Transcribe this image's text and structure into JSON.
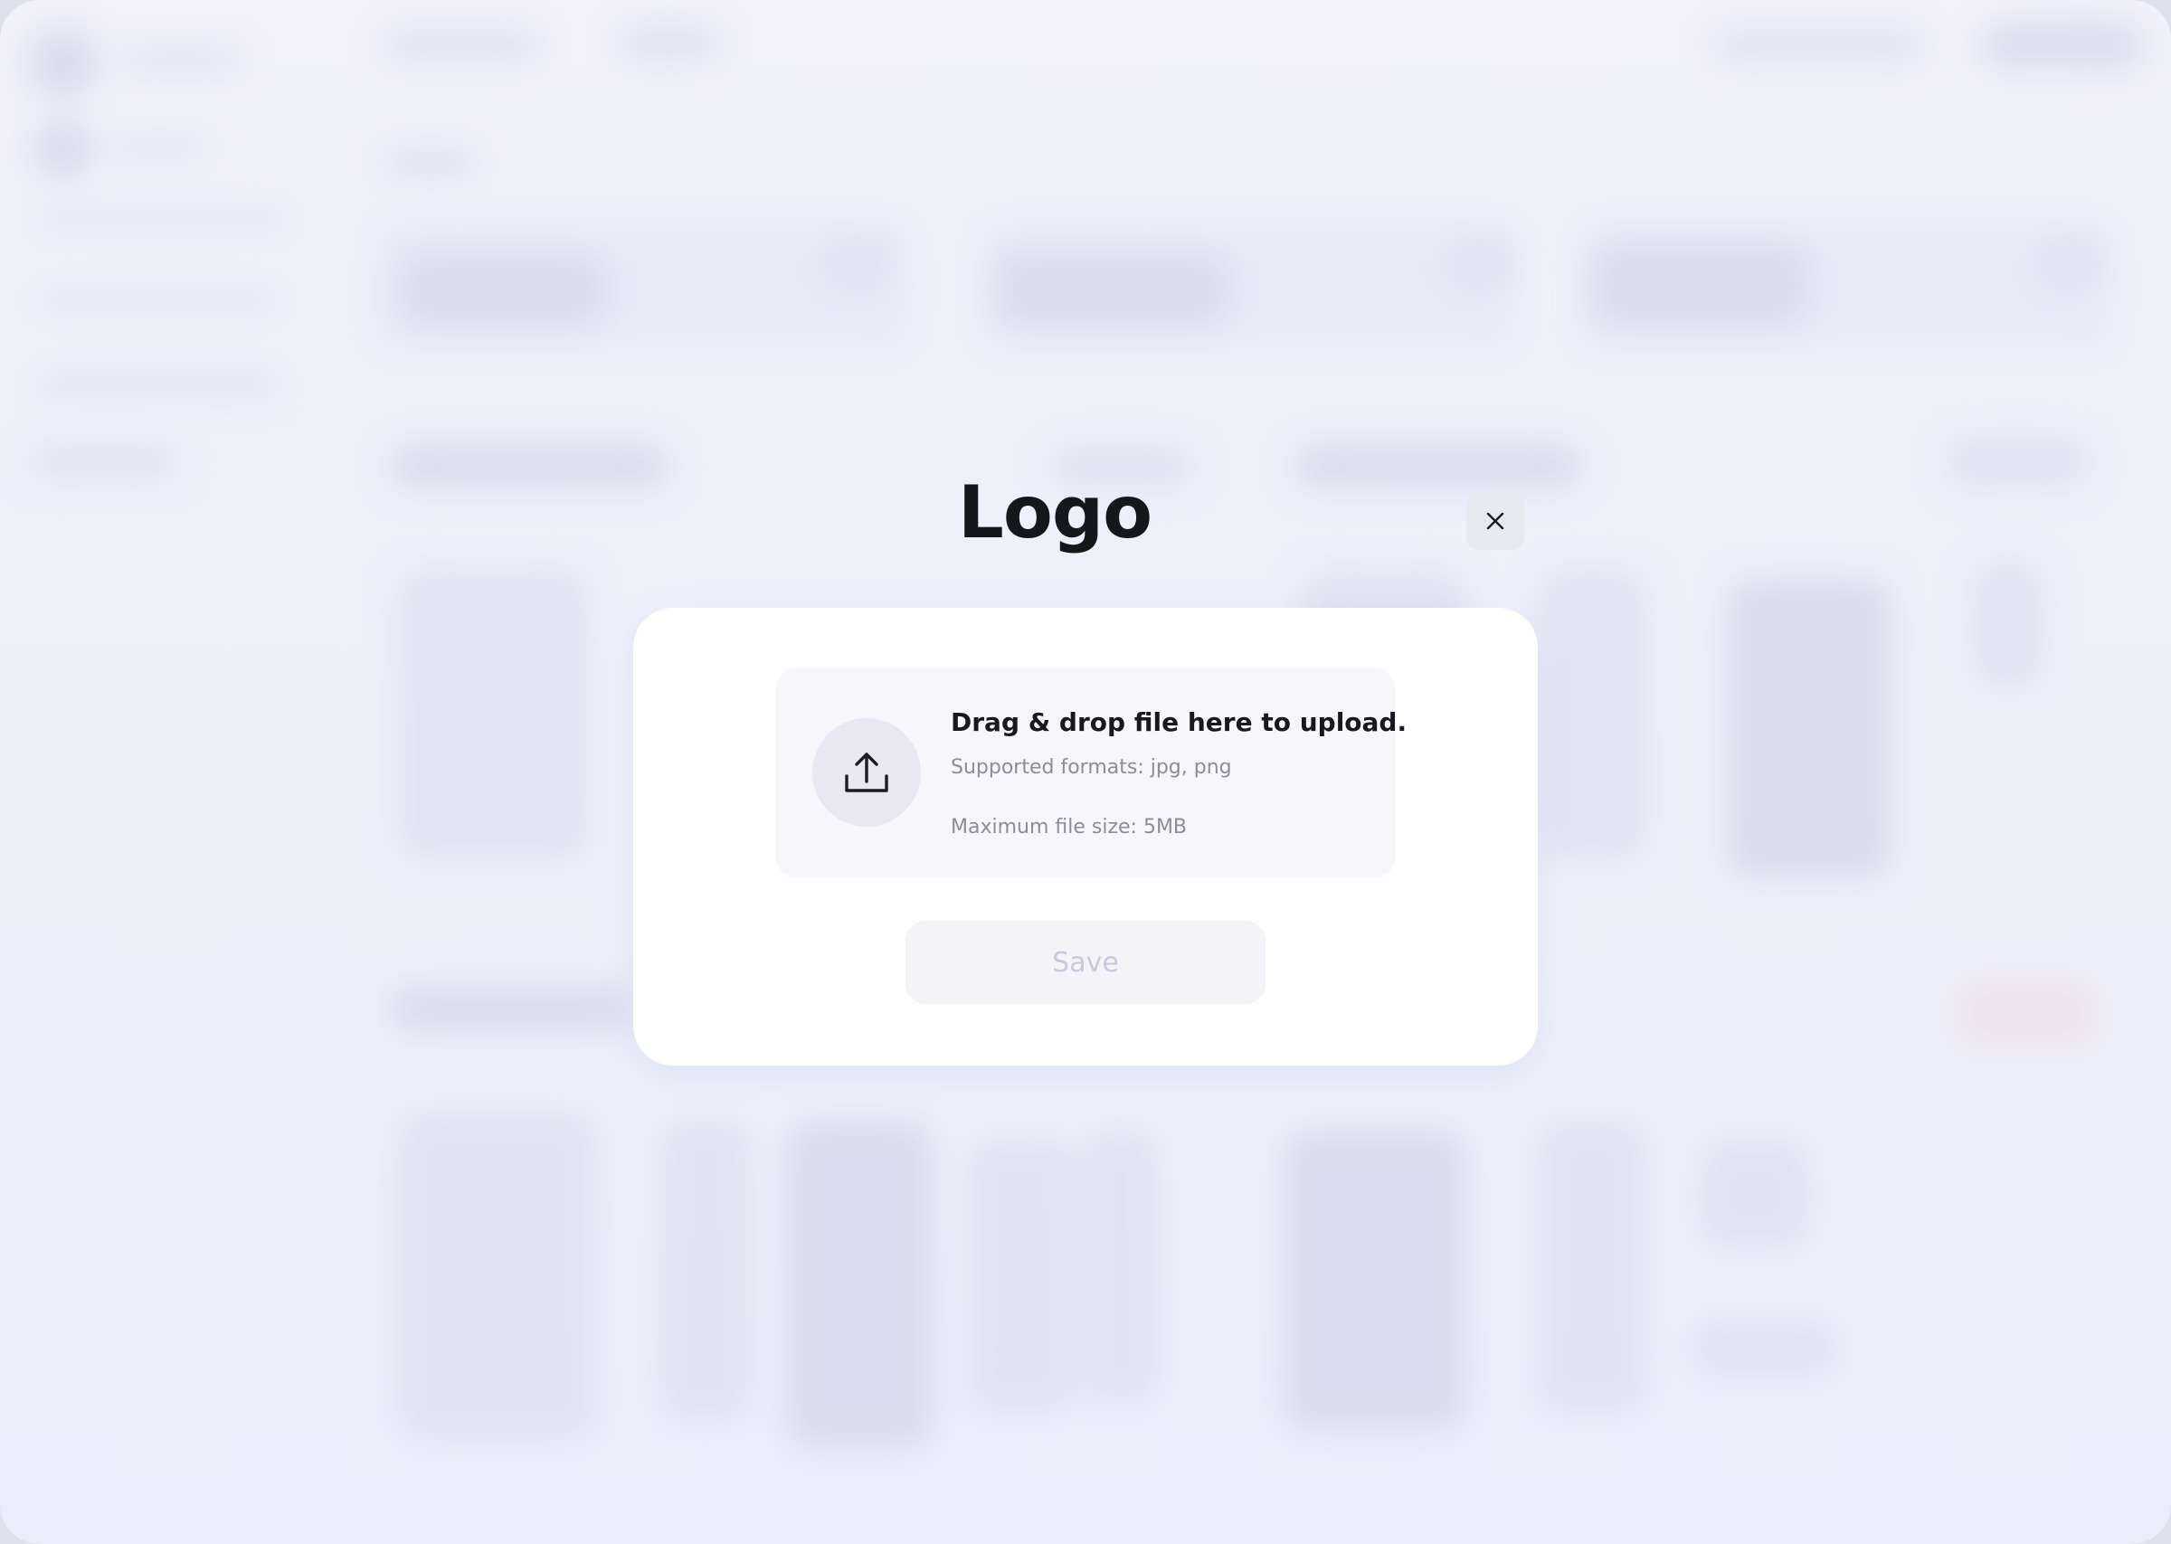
{
  "dialog": {
    "title": "Logo",
    "close_icon": "close-icon",
    "dropzone": {
      "icon": "upload-icon",
      "heading": "Drag & drop file here to upload.",
      "formats": "Supported formats: jpg, png",
      "max_size": "Maximum file size: 5MB"
    },
    "save_label": "Save",
    "save_disabled": true
  },
  "colors": {
    "title": "#16161d",
    "muted_text": "#8d8d98",
    "disabled_button_text": "#c8c9df",
    "backdrop": "#eceffb"
  }
}
